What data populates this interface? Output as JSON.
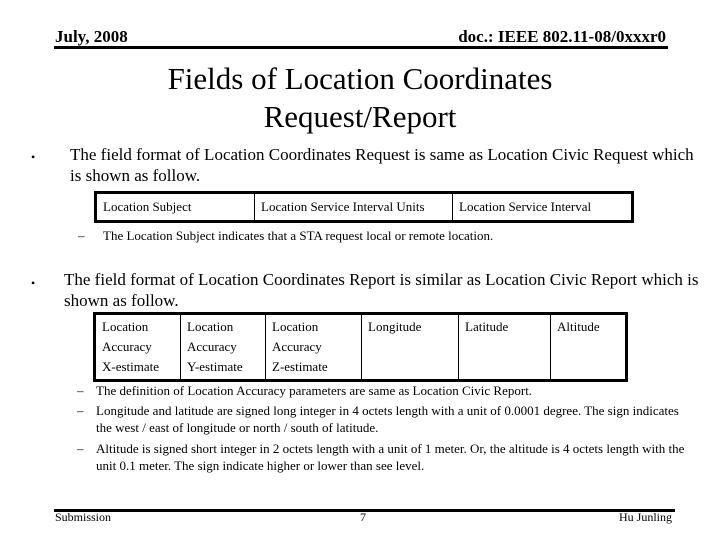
{
  "header": {
    "date": "July, 2008",
    "doc_id": "doc.: IEEE 802.11-08/0xxxr0"
  },
  "title": {
    "line1": "Fields of Location Coordinates",
    "line2": "Request/Report"
  },
  "bullets": [
    {
      "marker": "•",
      "text": "The field format of Location Coordinates Request is same as Location Civic Request which is shown as follow.",
      "table": {
        "cells": [
          "Location Subject",
          "Location Service Interval Units",
          "Location Service Interval"
        ]
      },
      "sub_items": [
        {
          "marker": "–",
          "text": "The Location Subject indicates that a STA request local or remote location."
        }
      ]
    },
    {
      "marker": "•",
      "text": "The field format of Location Coordinates Report is similar as Location Civic Report which is shown as follow.",
      "table": {
        "cells": [
          {
            "l1": "Location",
            "l2": "Accuracy",
            "l3": "X-estimate"
          },
          {
            "l1": "Location",
            "l2": "Accuracy",
            "l3": "Y-estimate"
          },
          {
            "l1": "Location",
            "l2": "Accuracy",
            "l3": "Z-estimate"
          },
          {
            "l1": "Longitude",
            "l2": "",
            "l3": ""
          },
          {
            "l1": "Latitude",
            "l2": "",
            "l3": ""
          },
          {
            "l1": "Altitude",
            "l2": "",
            "l3": ""
          }
        ]
      },
      "sub_items": [
        {
          "marker": "–",
          "text": "The definition of Location Accuracy parameters are same as Location Civic Report."
        },
        {
          "marker": "–",
          "text": "Longitude and latitude are signed long integer in 4 octets length with a unit of 0.0001 degree. The sign indicates the west / east of longitude or north / south of latitude."
        },
        {
          "marker": "–",
          "text": "Altitude is signed short integer in 2 octets length with a unit of 1 meter. Or, the altitude is 4 octets length with the unit 0.1 meter. The sign indicate higher or lower than see level."
        }
      ]
    }
  ],
  "footer": {
    "left": "Submission",
    "page_number": "7",
    "author": "Hu Junling"
  }
}
